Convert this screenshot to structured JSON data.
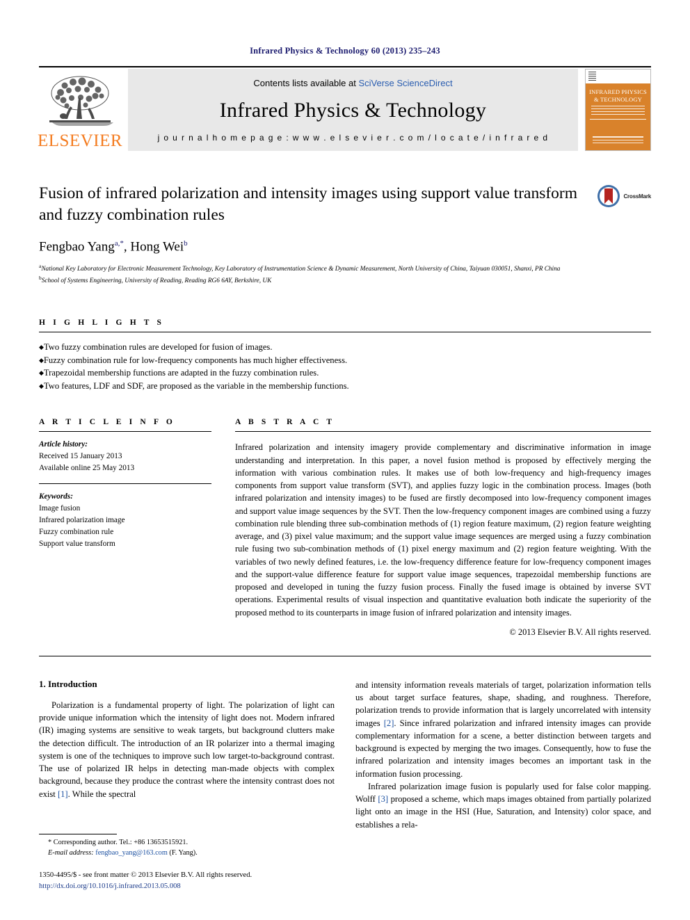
{
  "running_head": "Infrared Physics & Technology 60 (2013) 235–243",
  "masthead": {
    "publisher_name": "ELSEVIER",
    "contents_prefix": "Contents lists available at ",
    "contents_link": "SciVerse ScienceDirect",
    "journal_name": "Infrared Physics & Technology",
    "homepage_line": "j o u r n a l   h o m e p a g e :   w w w . e l s e v i e r . c o m / l o c a t e / i n f r a r e d",
    "cover_title": "INFRARED PHYSICS & TECHNOLOGY",
    "link_color": "#2a5db0",
    "elsevier_orange": "#f47c20",
    "cover_orange": "#d9822b"
  },
  "article": {
    "title": "Fusion of infrared polarization and intensity images using support value transform and fuzzy combination rules",
    "crossmark_label": "CrossMark",
    "authors_line": "Fengbao Yang",
    "author_a_sup": "a,*",
    "authors_line2": ", Hong Wei",
    "author_b_sup": "b",
    "affiliation_a_sup": "a",
    "affiliation_a": "National Key Laboratory for Electronic Measurement Technology, Key Laboratory of Instrumentation Science & Dynamic Measurement, North University of China, Taiyuan 030051, Shanxi, PR China",
    "affiliation_b_sup": "b",
    "affiliation_b": "School of Systems Engineering, University of Reading, Reading RG6 6AY, Berkshire, UK"
  },
  "highlights": {
    "heading": "H I G H L I G H T S",
    "items": [
      "Two fuzzy combination rules are developed for fusion of images.",
      "Fuzzy combination rule for low-frequency components has much higher effectiveness.",
      "Trapezoidal membership functions are adapted in the fuzzy combination rules.",
      "Two features, LDF and SDF, are proposed as the variable in the membership functions."
    ]
  },
  "article_info": {
    "heading": "A R T I C L E    I N F O",
    "history_label": "Article history:",
    "received": "Received 15 January 2013",
    "available": "Available online 25 May 2013",
    "keywords_label": "Keywords:",
    "keywords": [
      "Image fusion",
      "Infrared polarization image",
      "Fuzzy combination rule",
      "Support value transform"
    ]
  },
  "abstract": {
    "heading": "A B S T R A C T",
    "text": "Infrared polarization and intensity imagery provide complementary and discriminative information in image understanding and interpretation. In this paper, a novel fusion method is proposed by effectively merging the information with various combination rules. It makes use of both low-frequency and high-frequency images components from support value transform (SVT), and applies fuzzy logic in the combination process. Images (both infrared polarization and intensity images) to be fused are firstly decomposed into low-frequency component images and support value image sequences by the SVT. Then the low-frequency component images are combined using a fuzzy combination rule blending three sub-combination methods of (1) region feature maximum, (2) region feature weighting average, and (3) pixel value maximum; and the support value image sequences are merged using a fuzzy combination rule fusing two sub-combination methods of (1) pixel energy maximum and (2) region feature weighting. With the variables of two newly defined features, i.e. the low-frequency difference feature for low-frequency component images and the support-value difference feature for support value image sequences, trapezoidal membership functions are proposed and developed in tuning the fuzzy fusion process. Finally the fused image is obtained by inverse SVT operations. Experimental results of visual inspection and quantitative evaluation both indicate the superiority of the proposed method to its counterparts in image fusion of infrared polarization and intensity images.",
    "copyright": "© 2013 Elsevier B.V. All rights reserved."
  },
  "body": {
    "section_heading": "1. Introduction",
    "left_para_1": "Polarization is a fundamental property of light. The polarization of light can provide unique information which the intensity of light does not. Modern infrared (IR) imaging systems are sensitive to weak targets, but background clutters make the detection difficult. The introduction of an IR polarizer into a thermal imaging system is one of the techniques to improve such low target-to-background contrast. The use of polarized IR helps in detecting man-made objects with complex background, because they produce the contrast where the intensity contrast does not exist ",
    "left_ref_1": "[1]",
    "left_para_1_end": ". While the spectral",
    "right_para_1_start": "and intensity information reveals materials of target, polarization information tells us about target surface features, shape, shading, and roughness. Therefore, polarization trends to provide information that is largely uncorrelated with intensity images ",
    "right_ref_2": "[2]",
    "right_para_1_end": ". Since infrared polarization and infrared intensity images can provide complementary information for a scene, a better distinction between targets and background is expected by merging the two images. Consequently, how to fuse the infrared polarization and intensity images becomes an important task in the information fusion processing.",
    "right_para_2_start": "Infrared polarization image fusion is popularly used for false color mapping. Wolff ",
    "right_ref_3": "[3]",
    "right_para_2_end": " proposed a scheme, which maps images obtained from partially polarized light onto an image in the HSI (Hue, Saturation, and Intensity) color space, and establishes a rela-"
  },
  "footnotes": {
    "corresponding": "* Corresponding author. Tel.: +86 13653515921.",
    "email_label": "E-mail address:",
    "email": "fengbao_yang@163.com",
    "email_suffix": "(F. Yang).",
    "imprint": "1350-4495/$ - see front matter © 2013 Elsevier B.V. All rights reserved.",
    "doi": "http://dx.doi.org/10.1016/j.infrared.2013.05.008"
  }
}
